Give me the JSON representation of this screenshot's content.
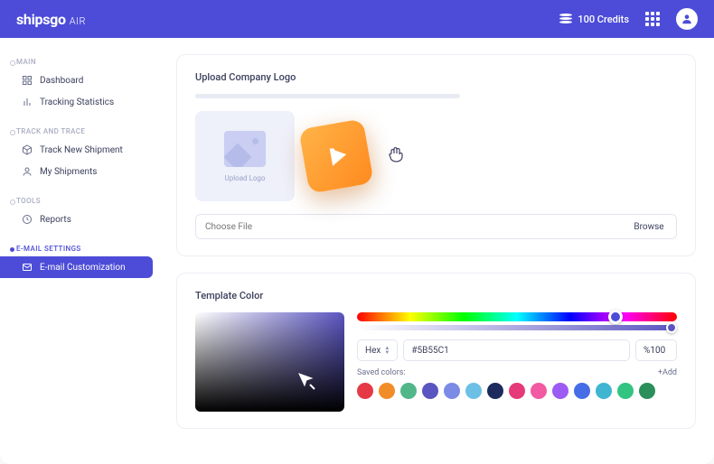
{
  "header": {
    "brand": "shipsgo",
    "brandSub": "AIR",
    "credits": "100 Credits"
  },
  "sidebar": {
    "groups": [
      {
        "label": "MAIN",
        "items": [
          {
            "label": "Dashboard",
            "icon": "dashboard"
          },
          {
            "label": "Tracking Statistics",
            "icon": "stats"
          }
        ]
      },
      {
        "label": "TRACK AND TRACE",
        "items": [
          {
            "label": "Track New Shipment",
            "icon": "package"
          },
          {
            "label": "My Shipments",
            "icon": "user"
          }
        ]
      },
      {
        "label": "TOOLS",
        "items": [
          {
            "label": "Reports",
            "icon": "clock"
          }
        ]
      },
      {
        "label": "E-MAIL SETTINGS",
        "active": true,
        "items": [
          {
            "label": "E-mail Customization",
            "icon": "mail",
            "active": true
          }
        ]
      }
    ]
  },
  "uploadCard": {
    "title": "Upload Company Logo",
    "boxLabel": "Upload Logo",
    "placeholder": "Choose File",
    "browseLabel": "Browse"
  },
  "colorCard": {
    "title": "Template Color",
    "format": "Hex",
    "hex": "#5B55C1",
    "opacity": "%100",
    "savedLabel": "Saved colors:",
    "addLabel": "+Add",
    "swatches": [
      "#e63946",
      "#f28c28",
      "#52b788",
      "#5B55C1",
      "#7b8be6",
      "#6cc0e6",
      "#1d2a5e",
      "#e6397a",
      "#f25aa3",
      "#9c5bf2",
      "#476de6",
      "#3fb5d1",
      "#33c481",
      "#2a8f5a"
    ]
  }
}
